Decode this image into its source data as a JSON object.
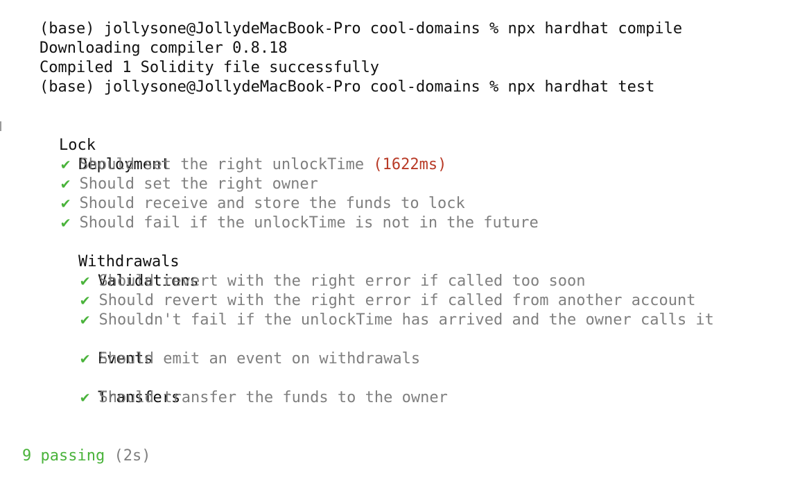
{
  "terminal": {
    "prompt_compile": "(base) jollysone@JollydeMacBook-Pro cool-domains % npx hardhat compile",
    "download_msg": "Downloading compiler 0.8.18",
    "compiled_msg": "Compiled 1 Solidity file successfully",
    "prompt_test": "(base) jollysone@JollydeMacBook-Pro cool-domains % npx hardhat test",
    "check_glyph": "✔",
    "suite_root": "Lock",
    "deployment": {
      "label": "Deployment",
      "tests": [
        "Should set the right unlockTime",
        "Should set the right owner",
        "Should receive and store the funds to lock",
        "Should fail if the unlockTime is not in the future"
      ],
      "slow_duration": "(1622ms)"
    },
    "withdrawals": {
      "label": "Withdrawals",
      "validations": {
        "label": "Validations",
        "tests": [
          "Should revert with the right error if called too soon",
          "Should revert with the right error if called from another account",
          "Shouldn't fail if the unlockTime has arrived and the owner calls it"
        ]
      },
      "events": {
        "label": "Events",
        "tests": [
          "Should emit an event on withdrawals"
        ]
      },
      "transfers": {
        "label": "Transfers",
        "tests": [
          "Should transfer the funds to the owner"
        ]
      }
    },
    "summary": {
      "passing": "9 passing",
      "duration": "(2s)"
    },
    "colors": {
      "check": "#4ab33b",
      "slow": "#b83a26",
      "muted": "#7f7f7f",
      "text": "#111111"
    }
  }
}
